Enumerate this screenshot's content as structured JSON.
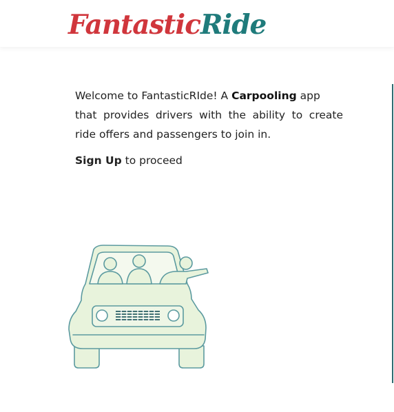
{
  "header": {
    "logo_part1": "Fantastic",
    "logo_part2": "Ride"
  },
  "intro": {
    "text_before": "Welcome to FantasticRIde! A ",
    "bold_word": "Carpooling",
    "text_after": " app",
    "line2": "that provides drivers with the ability to create ride offers and passengers to join in."
  },
  "proceed": {
    "link_label": "Sign Up",
    "suffix": " to proceed"
  },
  "illustration": {
    "icon": "carpool-car-illustration",
    "fill_color": "#e8f3dc",
    "stroke_color": "#5b9a9f"
  },
  "colors": {
    "brand_red": "#d0363c",
    "brand_teal": "#1f7b7b"
  }
}
